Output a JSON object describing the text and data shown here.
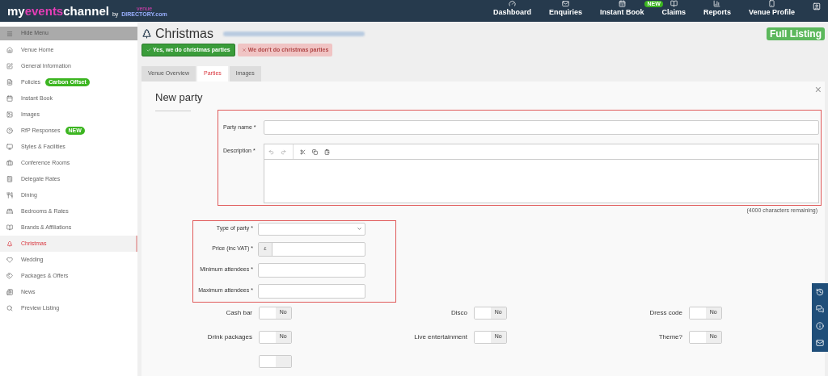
{
  "header": {
    "logo": {
      "part_1": "my",
      "part_2": "events",
      "part_3": "channel",
      "by": "by",
      "brand_top": "venue",
      "brand_bottom": "DIRECTORY.com"
    },
    "nav": [
      {
        "label": "Dashboard"
      },
      {
        "label": "Enquiries"
      },
      {
        "label": "Instant Book",
        "badge": "NEW"
      },
      {
        "label": "Claims"
      },
      {
        "label": "Reports"
      },
      {
        "label": "Venue Profile"
      }
    ]
  },
  "sidebar": {
    "toggle": "Hide Menu",
    "items": [
      {
        "label": "Venue Home",
        "selected": false
      },
      {
        "label": "General Information",
        "selected": false
      },
      {
        "label": "Policies",
        "selected": false,
        "badge": "Carbon Offset"
      },
      {
        "label": "Instant Book",
        "selected": false
      },
      {
        "label": "Images",
        "selected": false
      },
      {
        "label": "RfP Responses",
        "selected": false,
        "badge": "NEW"
      },
      {
        "label": "Styles & Facilities",
        "selected": false
      },
      {
        "label": "Conference Rooms",
        "selected": false
      },
      {
        "label": "Delegate Rates",
        "selected": false
      },
      {
        "label": "Dining",
        "selected": false
      },
      {
        "label": "Bedrooms & Rates",
        "selected": false
      },
      {
        "label": "Brands & Affiliations",
        "selected": false
      },
      {
        "label": "Christmas",
        "selected": true
      },
      {
        "label": "Wedding",
        "selected": false
      },
      {
        "label": "Packages & Offers",
        "selected": false
      },
      {
        "label": "News",
        "selected": false
      },
      {
        "label": "Preview Listing",
        "selected": false
      }
    ]
  },
  "page": {
    "title": "Christmas",
    "listing_badge": "Full Listing",
    "choices": [
      {
        "label": "Yes, we do christmas parties",
        "selected": true
      },
      {
        "label": "We don't do christmas parties",
        "selected": false
      }
    ],
    "tabs": [
      {
        "label": "Venue Overview",
        "selected": false
      },
      {
        "label": "Parties",
        "selected": true
      },
      {
        "label": "Images",
        "selected": false
      }
    ]
  },
  "form": {
    "title": "New party",
    "close": "×",
    "party_name": {
      "label": "Party name",
      "required_mark": "*"
    },
    "description": {
      "label": "Description",
      "required_mark": "*",
      "remaining": "(4000 characters remaining)"
    },
    "fields": [
      {
        "kind": "select",
        "label": "Type of party",
        "required_mark": "*"
      },
      {
        "kind": "currency",
        "label": "Price (inc VAT)",
        "required_mark": "*",
        "prefix": "£"
      },
      {
        "kind": "text",
        "label": "Minimum attendees",
        "required_mark": "*"
      },
      {
        "kind": "text",
        "label": "Maximum attendees",
        "required_mark": "*"
      }
    ],
    "toggles": [
      {
        "label": "Cash bar",
        "on": false,
        "state_text": "No"
      },
      {
        "label": "Disco",
        "on": false,
        "state_text": "No"
      },
      {
        "label": "Dress code",
        "on": false,
        "state_text": "No"
      },
      {
        "label": "Drink packages",
        "on": false,
        "state_text": "No"
      },
      {
        "label": "Live entertainment",
        "on": false,
        "state_text": "No"
      },
      {
        "label": "Theme?",
        "on": false,
        "state_text": "No"
      },
      {
        "on": false
      }
    ]
  }
}
